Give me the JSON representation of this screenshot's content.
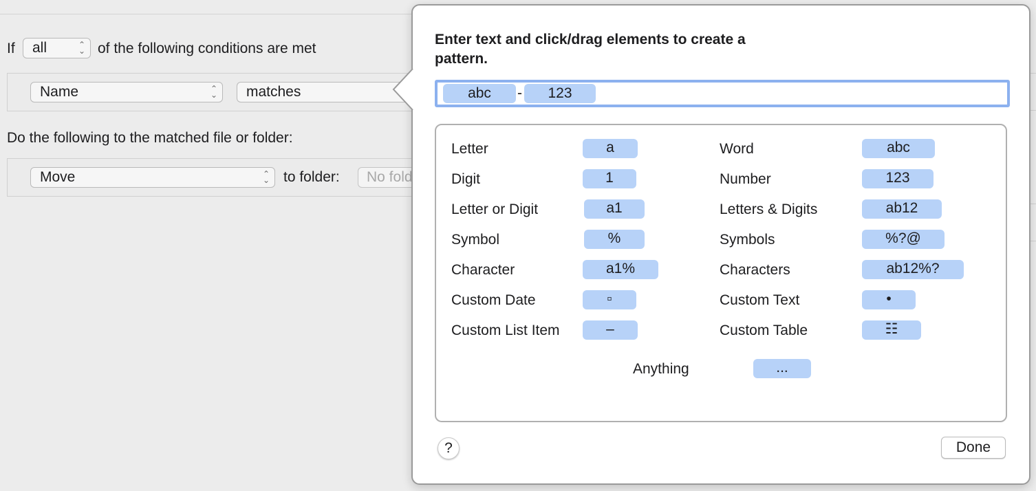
{
  "rule": {
    "if_label": "If",
    "match_mode": "all",
    "conditions_suffix": "of the following conditions are met",
    "condition": {
      "attribute": "Name",
      "operator": "matches"
    },
    "actions_heading": "Do the following to the matched file or folder:",
    "action": {
      "verb": "Move",
      "to_folder_label": "to folder:",
      "folder_placeholder": "No folder"
    }
  },
  "popover": {
    "title": "Enter text and click/drag elements to create a pattern.",
    "pattern_tokens": [
      {
        "label": "abc"
      },
      {
        "label": "123"
      }
    ],
    "pattern_separator": "-",
    "elements": {
      "letter": {
        "label": "Letter",
        "token": "a"
      },
      "digit": {
        "label": "Digit",
        "token": "1"
      },
      "letter_or_digit": {
        "label": "Letter or Digit",
        "token": "a1"
      },
      "symbol": {
        "label": "Symbol",
        "token": "%"
      },
      "character": {
        "label": "Character",
        "token": "a1%"
      },
      "custom_date": {
        "label": "Custom Date",
        "token": "▫"
      },
      "custom_list_item": {
        "label": "Custom List Item",
        "token": "–"
      },
      "word": {
        "label": "Word",
        "token": "abc"
      },
      "number": {
        "label": "Number",
        "token": "123"
      },
      "letters_digits": {
        "label": "Letters & Digits",
        "token": "ab12"
      },
      "symbols": {
        "label": "Symbols",
        "token": "%?@"
      },
      "characters": {
        "label": "Characters",
        "token": "ab12%?"
      },
      "custom_text": {
        "label": "Custom Text",
        "token": "•"
      },
      "custom_table": {
        "label": "Custom Table",
        "token": "☷"
      },
      "anything": {
        "label": "Anything",
        "token": "..."
      }
    },
    "help_label": "?",
    "done_label": "Done"
  }
}
